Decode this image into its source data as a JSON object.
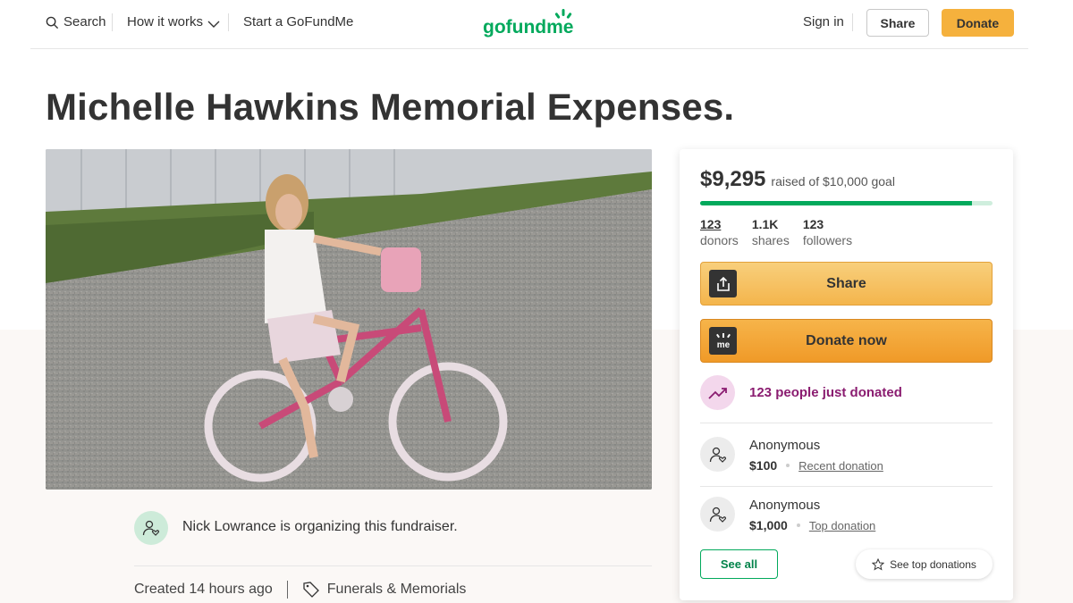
{
  "header": {
    "search_label": "Search",
    "how_it_works_label": "How it works",
    "start_label": "Start a GoFundMe",
    "logo_text": "gofundme",
    "sign_in_label": "Sign in",
    "share_label": "Share",
    "donate_label": "Donate"
  },
  "page": {
    "title": "Michelle Hawkins Memorial Expenses."
  },
  "organizer": {
    "text": "Nick Lowrance is organizing this fundraiser."
  },
  "meta": {
    "created": "Created 14 hours ago",
    "category": "Funerals & Memorials"
  },
  "card": {
    "amount_raised": "$9,295",
    "goal_text": "raised of $10,000 goal",
    "progress_fraction": 0.9295,
    "stats": [
      {
        "value": "123",
        "label": "donors"
      },
      {
        "value": "1.1K",
        "label": "shares"
      },
      {
        "value": "123",
        "label": "followers"
      }
    ],
    "share_button": "Share",
    "donate_button": "Donate now",
    "trend_text": "123 people just donated",
    "donations": [
      {
        "name": "Anonymous",
        "amount": "$100",
        "tag": "Recent donation"
      },
      {
        "name": "Anonymous",
        "amount": "$1,000",
        "tag": "Top donation"
      }
    ],
    "see_all": "See all",
    "see_top": "See top donations"
  },
  "colors": {
    "brand_green": "#02a95c",
    "donate_orange": "#f5b13d",
    "trend_purple": "#8a1c70"
  },
  "icons": [
    "search-icon",
    "chevron-down-icon",
    "share-upload-icon",
    "gofundme-me-icon",
    "trending-up-icon",
    "person-heart-icon",
    "tag-icon",
    "star-icon"
  ]
}
